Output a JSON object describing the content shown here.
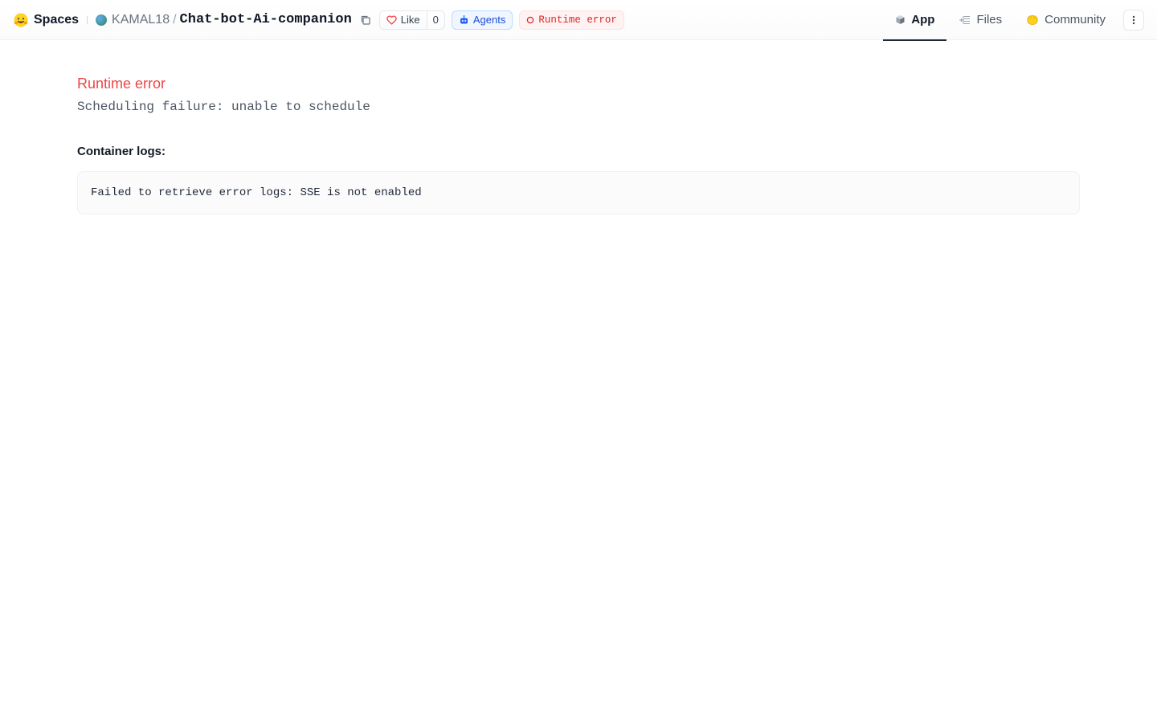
{
  "header": {
    "brand": "Spaces",
    "owner": "KAMAL18",
    "separator": "/",
    "repo_name": "Chat-bot-Ai-companion",
    "like_label": "Like",
    "like_count": "0",
    "agents_label": "Agents",
    "status_label": "Runtime error",
    "tabs": [
      {
        "label": "App",
        "icon": "app-cube-icon",
        "active": true
      },
      {
        "label": "Files",
        "icon": "files-icon",
        "active": false
      },
      {
        "label": "Community",
        "icon": "community-icon",
        "active": false
      }
    ]
  },
  "main": {
    "error_title": "Runtime error",
    "error_detail": "Scheduling failure: unable to schedule",
    "logs_heading": "Container logs:",
    "logs_text": "Failed to retrieve error logs: SSE is not enabled"
  },
  "colors": {
    "error": "#ef4444",
    "agents": "#1d4ed8",
    "status_bg": "#fef2f2"
  }
}
